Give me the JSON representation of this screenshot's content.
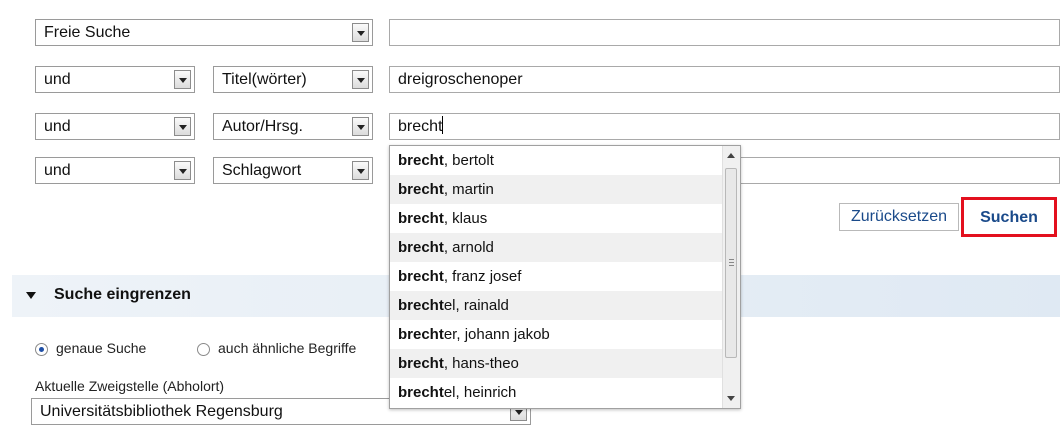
{
  "search_rows": [
    {
      "operator": "",
      "field": "Freie Suche",
      "value": ""
    },
    {
      "operator": "und",
      "field": "Titel(wörter)",
      "value": "dreigroschenoper"
    },
    {
      "operator": "und",
      "field": "Autor/Hrsg.",
      "value": "brecht"
    },
    {
      "operator": "und",
      "field": "Schlagwort",
      "value": ""
    }
  ],
  "buttons": {
    "reset": "Zurücksetzen",
    "search": "Suchen"
  },
  "autocomplete": {
    "items": [
      {
        "match": "brecht",
        "rest": ", bertolt"
      },
      {
        "match": "brecht",
        "rest": ", martin"
      },
      {
        "match": "brecht",
        "rest": ", klaus"
      },
      {
        "match": "brecht",
        "rest": ", arnold"
      },
      {
        "match": "brecht",
        "rest": ", franz josef"
      },
      {
        "match": "brecht",
        "rest": "el, rainald"
      },
      {
        "match": "brecht",
        "rest": "er, johann jakob"
      },
      {
        "match": "brecht",
        "rest": ", hans-theo"
      },
      {
        "match": "brecht",
        "rest": "el, heinrich"
      }
    ]
  },
  "refine": {
    "title": "Suche eingrenzen",
    "exact_label": "genaue Suche",
    "similar_label": "auch ähnliche Begriffe",
    "branch_label": "Aktuelle Zweigstelle (Abholort)",
    "branch_value": "Universitätsbibliothek Regensburg"
  },
  "colors": {
    "highlight_border": "#e3101e",
    "button_text": "#1a4a8a"
  }
}
